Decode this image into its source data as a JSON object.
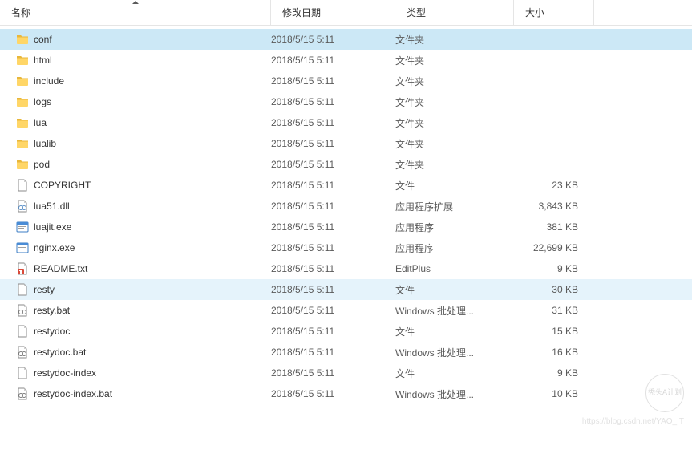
{
  "columns": {
    "name": "名称",
    "date": "修改日期",
    "type": "类型",
    "size": "大小"
  },
  "files": [
    {
      "name": "conf",
      "date": "2018/5/15 5:11",
      "type": "文件夹",
      "size": "",
      "icon": "folder",
      "state": "selected"
    },
    {
      "name": "html",
      "date": "2018/5/15 5:11",
      "type": "文件夹",
      "size": "",
      "icon": "folder",
      "state": ""
    },
    {
      "name": "include",
      "date": "2018/5/15 5:11",
      "type": "文件夹",
      "size": "",
      "icon": "folder",
      "state": ""
    },
    {
      "name": "logs",
      "date": "2018/5/15 5:11",
      "type": "文件夹",
      "size": "",
      "icon": "folder",
      "state": ""
    },
    {
      "name": "lua",
      "date": "2018/5/15 5:11",
      "type": "文件夹",
      "size": "",
      "icon": "folder",
      "state": ""
    },
    {
      "name": "lualib",
      "date": "2018/5/15 5:11",
      "type": "文件夹",
      "size": "",
      "icon": "folder",
      "state": ""
    },
    {
      "name": "pod",
      "date": "2018/5/15 5:11",
      "type": "文件夹",
      "size": "",
      "icon": "folder",
      "state": ""
    },
    {
      "name": "COPYRIGHT",
      "date": "2018/5/15 5:11",
      "type": "文件",
      "size": "23 KB",
      "icon": "file",
      "state": ""
    },
    {
      "name": "lua51.dll",
      "date": "2018/5/15 5:11",
      "type": "应用程序扩展",
      "size": "3,843 KB",
      "icon": "dll",
      "state": ""
    },
    {
      "name": "luajit.exe",
      "date": "2018/5/15 5:11",
      "type": "应用程序",
      "size": "381 KB",
      "icon": "exe",
      "state": ""
    },
    {
      "name": "nginx.exe",
      "date": "2018/5/15 5:11",
      "type": "应用程序",
      "size": "22,699 KB",
      "icon": "exe",
      "state": ""
    },
    {
      "name": "README.txt",
      "date": "2018/5/15 5:11",
      "type": "EditPlus",
      "size": "9 KB",
      "icon": "txt",
      "state": ""
    },
    {
      "name": "resty",
      "date": "2018/5/15 5:11",
      "type": "文件",
      "size": "30 KB",
      "icon": "file",
      "state": "hover"
    },
    {
      "name": "resty.bat",
      "date": "2018/5/15 5:11",
      "type": "Windows 批处理...",
      "size": "31 KB",
      "icon": "bat",
      "state": ""
    },
    {
      "name": "restydoc",
      "date": "2018/5/15 5:11",
      "type": "文件",
      "size": "15 KB",
      "icon": "file",
      "state": ""
    },
    {
      "name": "restydoc.bat",
      "date": "2018/5/15 5:11",
      "type": "Windows 批处理...",
      "size": "16 KB",
      "icon": "bat",
      "state": ""
    },
    {
      "name": "restydoc-index",
      "date": "2018/5/15 5:11",
      "type": "文件",
      "size": "9 KB",
      "icon": "file",
      "state": ""
    },
    {
      "name": "restydoc-index.bat",
      "date": "2018/5/15 5:11",
      "type": "Windows 批处理...",
      "size": "10 KB",
      "icon": "bat",
      "state": ""
    }
  ],
  "watermark": {
    "label": "秃头A计划",
    "url": "https://blog.csdn.net/YAO_IT"
  }
}
